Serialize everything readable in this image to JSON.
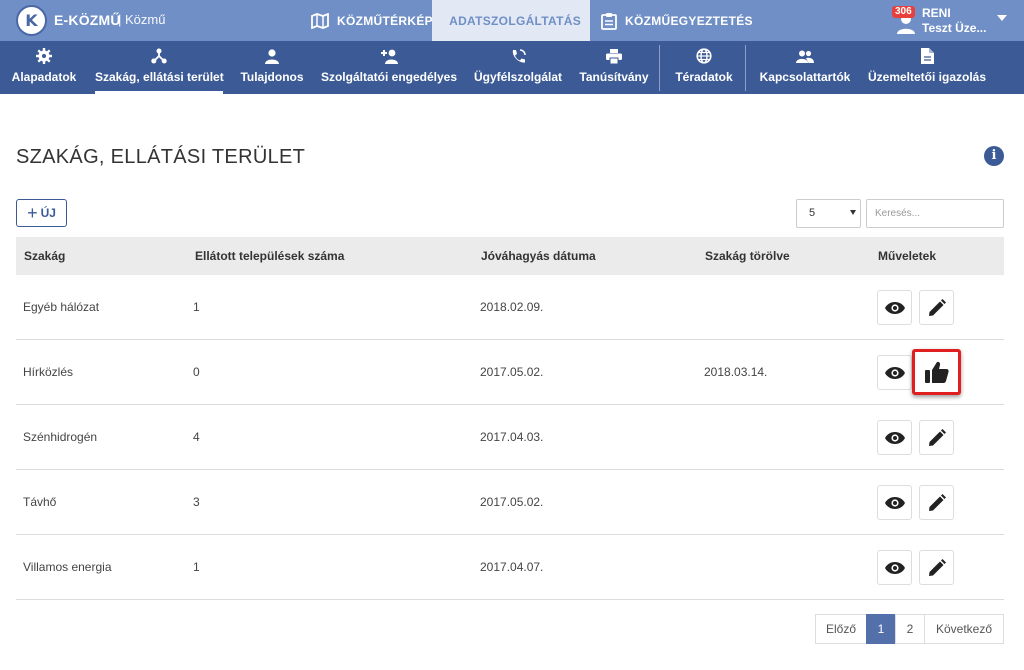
{
  "app": {
    "logo_letter": "K",
    "brand": "E-KÖZMŰ",
    "brand_sub": "| Közmű"
  },
  "topnav": [
    {
      "label": "KÖZMŰTÉRKÉP",
      "icon": "map-icon",
      "active": false
    },
    {
      "label": "ADATSZOLGÁLTATÁS",
      "icon": "id-card-icon",
      "active": true
    },
    {
      "label": "KÖZMŰEGYEZTETÉS",
      "icon": "clipboard-icon",
      "active": false
    }
  ],
  "user": {
    "badge": "306",
    "name": "RENI",
    "org": "Teszt Üze..."
  },
  "subnav": [
    {
      "label": "Alapadatok",
      "icon": "gear-icon"
    },
    {
      "label": "Szakág, ellátási terület",
      "icon": "sitemap-icon",
      "active": true
    },
    {
      "label": "Tulajdonos",
      "icon": "user-icon"
    },
    {
      "label": "Szolgáltatói engedélyes",
      "icon": "user-plus-icon"
    },
    {
      "label": "Ügyfélszolgálat",
      "icon": "phone-icon"
    },
    {
      "label": "Tanúsítvány",
      "icon": "printer-icon"
    },
    {
      "label": "Téradatok",
      "icon": "globe-icon"
    },
    {
      "label": "Kapcsolattartók",
      "icon": "users-icon"
    },
    {
      "label": "Üzemeltetői igazolás",
      "icon": "document-icon"
    }
  ],
  "page": {
    "title": "SZAKÁG, ELLÁTÁSI TERÜLET",
    "info": "i",
    "new_label": "ÚJ",
    "page_size": "5",
    "search_placeholder": "Keresés..."
  },
  "table": {
    "headers": [
      "Szakág",
      "Ellátott települések száma",
      "Jóváhagyás dátuma",
      "Szakág törölve",
      "Műveletek"
    ],
    "rows": [
      {
        "szakag": "Egyéb hálózat",
        "count": "1",
        "approved": "2018.02.09.",
        "deleted": "",
        "action2": "edit"
      },
      {
        "szakag": "Hírközlés",
        "count": "0",
        "approved": "2017.05.02.",
        "deleted": "2018.03.14.",
        "action2": "approve"
      },
      {
        "szakag": "Szénhidrogén",
        "count": "4",
        "approved": "2017.04.03.",
        "deleted": "",
        "action2": "edit"
      },
      {
        "szakag": "Távhő",
        "count": "3",
        "approved": "2017.05.02.",
        "deleted": "",
        "action2": "edit"
      },
      {
        "szakag": "Villamos energia",
        "count": "1",
        "approved": "2017.04.07.",
        "deleted": "",
        "action2": "edit"
      }
    ]
  },
  "pagination": {
    "prev": "Előző",
    "pages": [
      "1",
      "2"
    ],
    "current": "1",
    "next": "Következő"
  },
  "colors": {
    "topbar": "#6f8fc6",
    "subnav": "#3c5b96",
    "highlight": "#e02020",
    "pager_active": "#5470ab"
  }
}
